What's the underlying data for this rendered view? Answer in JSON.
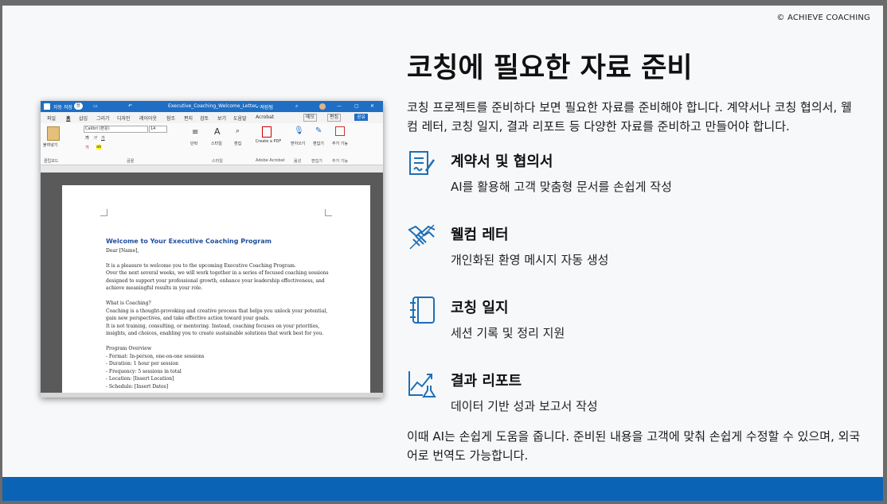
{
  "copyright": "© ACHIEVE COACHING",
  "title": "코칭에 필요한 자료 준비",
  "intro": "코칭 프로젝트를 준비하다 보면 필요한 자료를 준비해야 합니다. 계약서나 코칭 협의서, 웰컴 레터, 코칭 일지, 결과 리포트 등 다양한 자료를 준비하고 만들어야 합니다.",
  "features": [
    {
      "icon": "contract-sign-icon",
      "title": "계약서 및 협의서",
      "desc": "AI를 활용해 고객 맞춤형 문서를 손쉽게 작성"
    },
    {
      "icon": "handshake-icon",
      "title": "웰컴 레터",
      "desc": "개인화된 환영 메시지 자동 생성"
    },
    {
      "icon": "notebook-icon",
      "title": "코칭 일지",
      "desc": "세션 기록 및 정리 지원"
    },
    {
      "icon": "growth-chart-icon",
      "title": "결과 리포트",
      "desc": "데이터 기반 성과 보고서 작성"
    }
  ],
  "closing": "이때 AI는 손쉽게 도움을 줍니다. 준비된 내용을 고객에 맞춰 손쉽게 수정할 수 있으며, 외국어로 번역도 가능합니다.",
  "colors": {
    "accent": "#0b63b6",
    "icon": "#1f6fb5"
  },
  "word": {
    "autosave": "자동 저장",
    "toggle": "끔",
    "filename": "Executive_Coaching_Welcome_Letter - ...",
    "save_state": "• 저장됨",
    "menu": [
      "파일",
      "홈",
      "삽입",
      "그리기",
      "디자인",
      "레이아웃",
      "참조",
      "편지",
      "검토",
      "보기",
      "도움말",
      "Acrobat"
    ],
    "memo": "메모",
    "edit": "편집",
    "share": "공유",
    "paste_label": "붙여넣기",
    "font_name": "Calibri (본문)",
    "font_size": "14",
    "ribbon_labels": {
      "paragraph": "단락",
      "styles": "스타일",
      "editing": "편집",
      "create_pdf": "Create a PDF",
      "dictate": "받아쓰기",
      "editor": "편집기",
      "addins": "추가 기능"
    },
    "groups": {
      "clipboard": "클립보드",
      "font": "글꼴",
      "styles": "스타일",
      "acrobat": "Adobe Acrobat",
      "voice": "음성",
      "editor": "편집기",
      "addins": "추가 기능"
    },
    "doc_title": "Welcome to Your Executive Coaching Program",
    "doc_lines": [
      "Dear [Name],",
      "",
      "It is a pleasure to welcome you to the upcoming Executive Coaching Program.",
      "Over the next several weeks, we will work together in a series of focused coaching sessions",
      "designed to support your professional growth, enhance your leadership effectiveness, and",
      "achieve meaningful results in your role.",
      "",
      "What is Coaching?",
      "Coaching is a thought-provoking and creative process that helps you unlock your potential,",
      "gain new perspectives, and take effective action toward your goals.",
      "It is not training, consulting, or mentoring. Instead, coaching focuses on your priorities,",
      "insights, and choices, enabling you to create sustainable solutions that work best for you.",
      "",
      "Program Overview",
      "- Format: In-person, one-on-one sessions",
      "- Duration: 1 hour per session",
      "- Frequency: 5 sessions in total",
      "- Location: [Insert Location]",
      "- Schedule: [Insert Dates]"
    ]
  }
}
